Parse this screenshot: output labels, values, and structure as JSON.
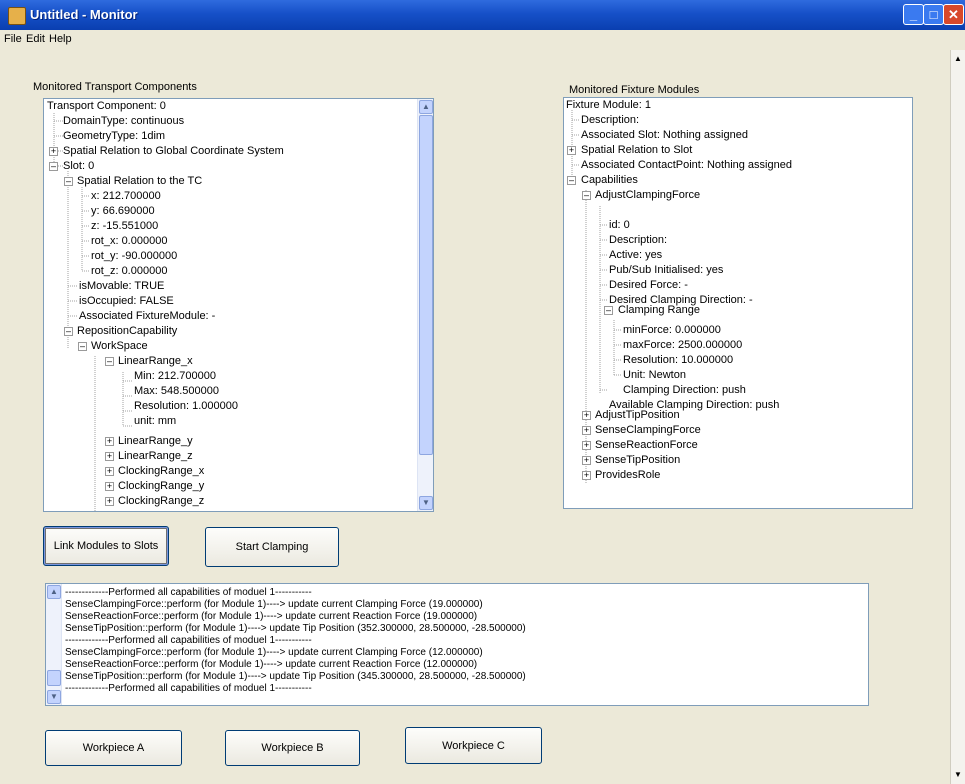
{
  "window": {
    "title": "Untitled - Monitor"
  },
  "menu": [
    "File",
    "Edit",
    "Help"
  ],
  "left_panel": {
    "label": "Monitored Transport Components",
    "items": [
      "Transport Component: 0",
      "DomainType: continuous",
      "GeometryType: 1dim",
      "Spatial Relation to Global Coordinate System",
      "Slot: 0",
      "Spatial Relation to the TC",
      "x: 212.700000",
      "y: 66.690000",
      "z: -15.551000",
      "rot_x: 0.000000",
      "rot_y: -90.000000",
      "rot_z: 0.000000",
      "isMovable: TRUE",
      "isOccupied: FALSE",
      "Associated FixtureModule: -",
      "RepositionCapability",
      "WorkSpace",
      "LinearRange_x",
      "Min: 212.700000",
      "Max: 548.500000",
      "Resolution: 1.000000",
      "unit: mm",
      "LinearRange_y",
      "LinearRange_z",
      "ClockingRange_x",
      "ClockingRange_y",
      "ClockingRange_z"
    ]
  },
  "right_panel": {
    "label": "Monitored Fixture Modules",
    "items": [
      "Fixture Module: 1",
      "Description:",
      "Associated Slot: Nothing assigned",
      "Spatial Relation to Slot",
      "Associated ContactPoint: Nothing assigned",
      "Capabilities",
      "AdjustClampingForce",
      "id: 0",
      "Description:",
      "Active: yes",
      "Pub/Sub Initialised: yes",
      "Desired Force: -",
      "Desired Clamping Direction: -",
      "Clamping Range",
      "minForce: 0.000000",
      "maxForce: 2500.000000",
      "Resolution: 10.000000",
      "Unit: Newton",
      "Clamping Direction: push",
      "Available Clamping Direction: push",
      "AdjustTipPosition",
      "SenseClampingForce",
      "SenseReactionForce",
      "SenseTipPosition",
      "ProvidesRole"
    ]
  },
  "buttons": {
    "link": "Link Modules to Slots",
    "start": "Start Clamping",
    "wa": "Workpiece A",
    "wb": "Workpiece B",
    "wc": "Workpiece C"
  },
  "log": [
    "-------------Performed all capabilities of moduel 1-----------",
    "SenseClampingForce::perform (for Module 1)----> update current Clamping Force (19.000000)",
    "SenseReactionForce::perform (for Module 1)----> update current Reaction Force (19.000000)",
    "SenseTipPosition::perform (for Module 1)----> update Tip Position (352.300000, 28.500000, -28.500000)",
    "-------------Performed all capabilities of moduel 1-----------",
    "SenseClampingForce::perform (for Module 1)----> update current Clamping Force (12.000000)",
    "SenseReactionForce::perform (for Module 1)----> update current Reaction Force (12.000000)",
    "SenseTipPosition::perform (for Module 1)----> update Tip Position (345.300000, 28.500000, -28.500000)",
    "-------------Performed all capabilities of moduel 1-----------"
  ],
  "colors": {
    "titlebar": "#1650c8",
    "dialog_bg": "#ece9d8",
    "close_button": "#d8482a"
  }
}
